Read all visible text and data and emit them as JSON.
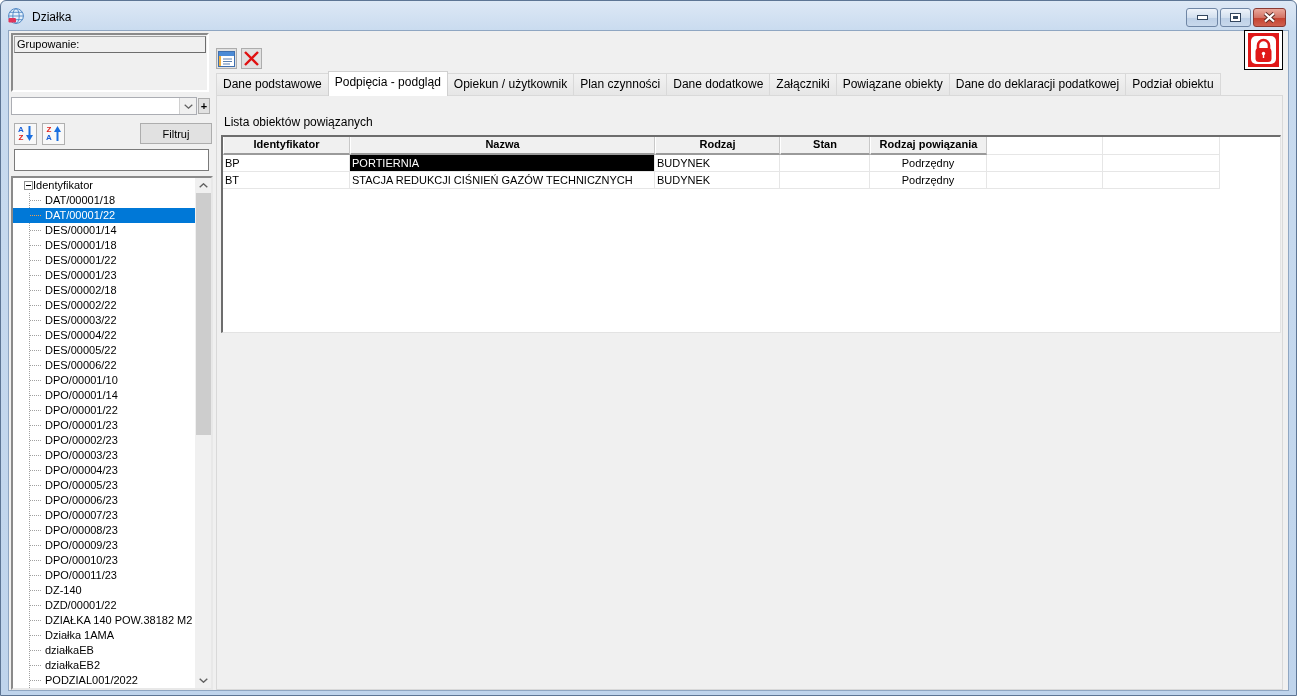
{
  "window": {
    "title": "Działka"
  },
  "left_panel": {
    "grouping": {
      "label": "Grupowanie:"
    },
    "group_add_button": "+",
    "sort_buttons": [
      {
        "kind": "ascending",
        "letters": [
          "A",
          "Z"
        ]
      },
      {
        "kind": "descending",
        "letters": [
          "Z",
          "A"
        ]
      }
    ],
    "filter_button": "Filtruj",
    "tree": {
      "label": "Identyfikator",
      "expanded": true,
      "selected": false,
      "children": [
        {
          "label": "DAT/00001/18",
          "selected": false
        },
        {
          "label": "DAT/00001/22",
          "selected": true
        },
        {
          "label": "DES/00001/14",
          "selected": false
        },
        {
          "label": "DES/00001/18",
          "selected": false
        },
        {
          "label": "DES/00001/22",
          "selected": false
        },
        {
          "label": "DES/00001/23",
          "selected": false
        },
        {
          "label": "DES/00002/18",
          "selected": false
        },
        {
          "label": "DES/00002/22",
          "selected": false
        },
        {
          "label": "DES/00003/22",
          "selected": false
        },
        {
          "label": "DES/00004/22",
          "selected": false
        },
        {
          "label": "DES/00005/22",
          "selected": false
        },
        {
          "label": "DES/00006/22",
          "selected": false
        },
        {
          "label": "DPO/00001/10",
          "selected": false
        },
        {
          "label": "DPO/00001/14",
          "selected": false
        },
        {
          "label": "DPO/00001/22",
          "selected": false
        },
        {
          "label": "DPO/00001/23",
          "selected": false
        },
        {
          "label": "DPO/00002/23",
          "selected": false
        },
        {
          "label": "DPO/00003/23",
          "selected": false
        },
        {
          "label": "DPO/00004/23",
          "selected": false
        },
        {
          "label": "DPO/00005/23",
          "selected": false
        },
        {
          "label": "DPO/00006/23",
          "selected": false
        },
        {
          "label": "DPO/00007/23",
          "selected": false
        },
        {
          "label": "DPO/00008/23",
          "selected": false
        },
        {
          "label": "DPO/00009/23",
          "selected": false
        },
        {
          "label": "DPO/00010/23",
          "selected": false
        },
        {
          "label": "DPO/00011/23",
          "selected": false
        },
        {
          "label": "DZ-140",
          "selected": false
        },
        {
          "label": "DZD/00001/22",
          "selected": false
        },
        {
          "label": "DZIAŁKA 140 POW.38182 M2",
          "selected": false
        },
        {
          "label": "Działka 1AMA",
          "selected": false
        },
        {
          "label": "działkaEB",
          "selected": false
        },
        {
          "label": "działkaEB2",
          "selected": false
        },
        {
          "label": "PODZIAL001/2022",
          "selected": false
        }
      ]
    }
  },
  "tabs": [
    {
      "label": "Dane podstawowe",
      "selected": false
    },
    {
      "label": "Podpięcia - podgląd",
      "selected": true
    },
    {
      "label": "Opiekun / użytkownik",
      "selected": false
    },
    {
      "label": "Plan czynności",
      "selected": false
    },
    {
      "label": "Dane dodatkowe",
      "selected": false
    },
    {
      "label": "Załączniki",
      "selected": false
    },
    {
      "label": "Powiązane obiekty",
      "selected": false
    },
    {
      "label": "Dane do deklaracji podatkowej",
      "selected": false
    },
    {
      "label": "Podział obiektu",
      "selected": false
    }
  ],
  "panel": {
    "title": "Lista obiektów powiązanych",
    "table": {
      "columns": [
        "Identyfikator",
        "Nazwa",
        "Rodzaj",
        "Stan",
        "Rodzaj powiązania"
      ],
      "rows": [
        {
          "identyfikator": "BP",
          "nazwa": "PORTIERNIA",
          "rodzaj": "BUDYNEK",
          "rodzaj_powiazania": "Podrzędny",
          "selected": true
        },
        {
          "identyfikator": "BT",
          "nazwa": "STACJA REDUKCJI CIŚNIEŃ GAZÓW TECHNICZNYCH",
          "rodzaj": "BUDYNEK",
          "rodzaj_powiazania": "Podrzędny",
          "selected": false
        }
      ]
    }
  }
}
